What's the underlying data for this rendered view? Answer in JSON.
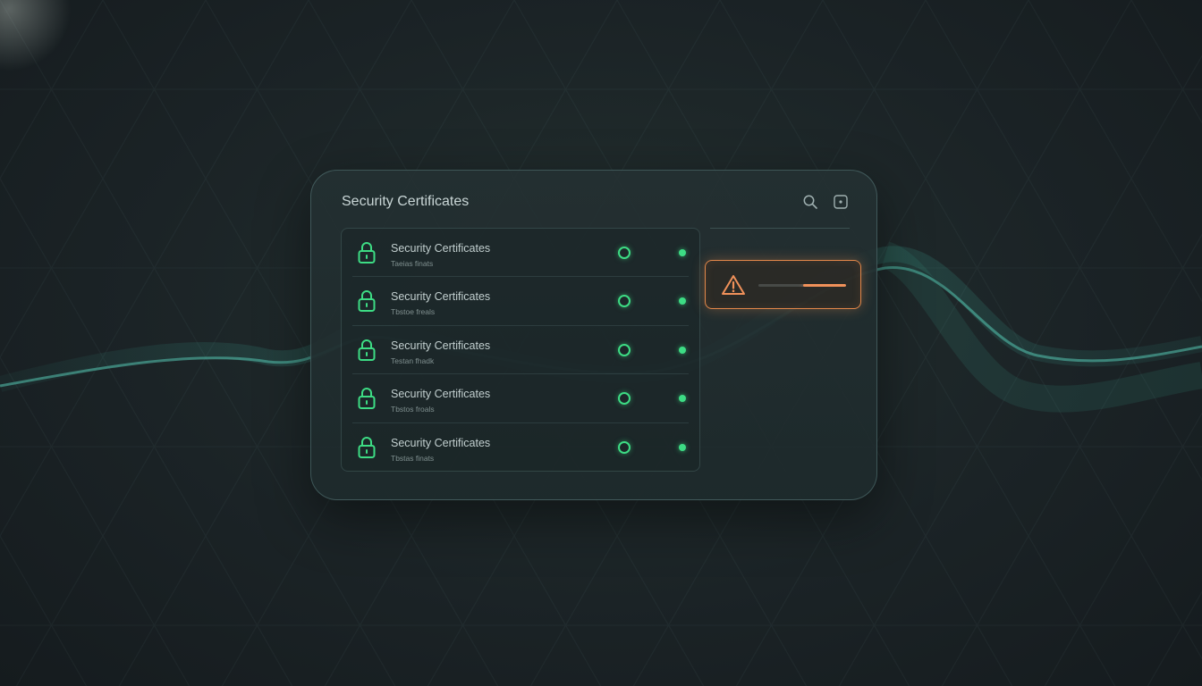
{
  "panel": {
    "title": "Security Certificates",
    "toolbar": {
      "search_icon": "search-icon",
      "expand_icon": "expand-icon"
    }
  },
  "certificates": [
    {
      "title": "Security Certificates",
      "subtitle": "Taeias finats",
      "icon": "lock-icon",
      "status_color": "#3ddc84"
    },
    {
      "title": "Security Certificates",
      "subtitle": "Tbstoe freals",
      "icon": "lock-icon",
      "status_color": "#3ddc84"
    },
    {
      "title": "Security Certificates",
      "subtitle": "Testan fhadk",
      "icon": "lock-icon",
      "status_color": "#3ddc84"
    },
    {
      "title": "Security Certificates",
      "subtitle": "Tbstos froals",
      "icon": "lock-icon",
      "status_color": "#3ddc84"
    },
    {
      "title": "Security Certificates",
      "subtitle": "Tbstas finats",
      "icon": "lock-icon",
      "status_color": "#3ddc84"
    }
  ],
  "alert": {
    "icon": "warning-icon",
    "progress": 0.49,
    "color": "#e3884a"
  },
  "colors": {
    "accent_green": "#3ddc84",
    "accent_orange": "#e3884a",
    "background": "#1b2326"
  }
}
